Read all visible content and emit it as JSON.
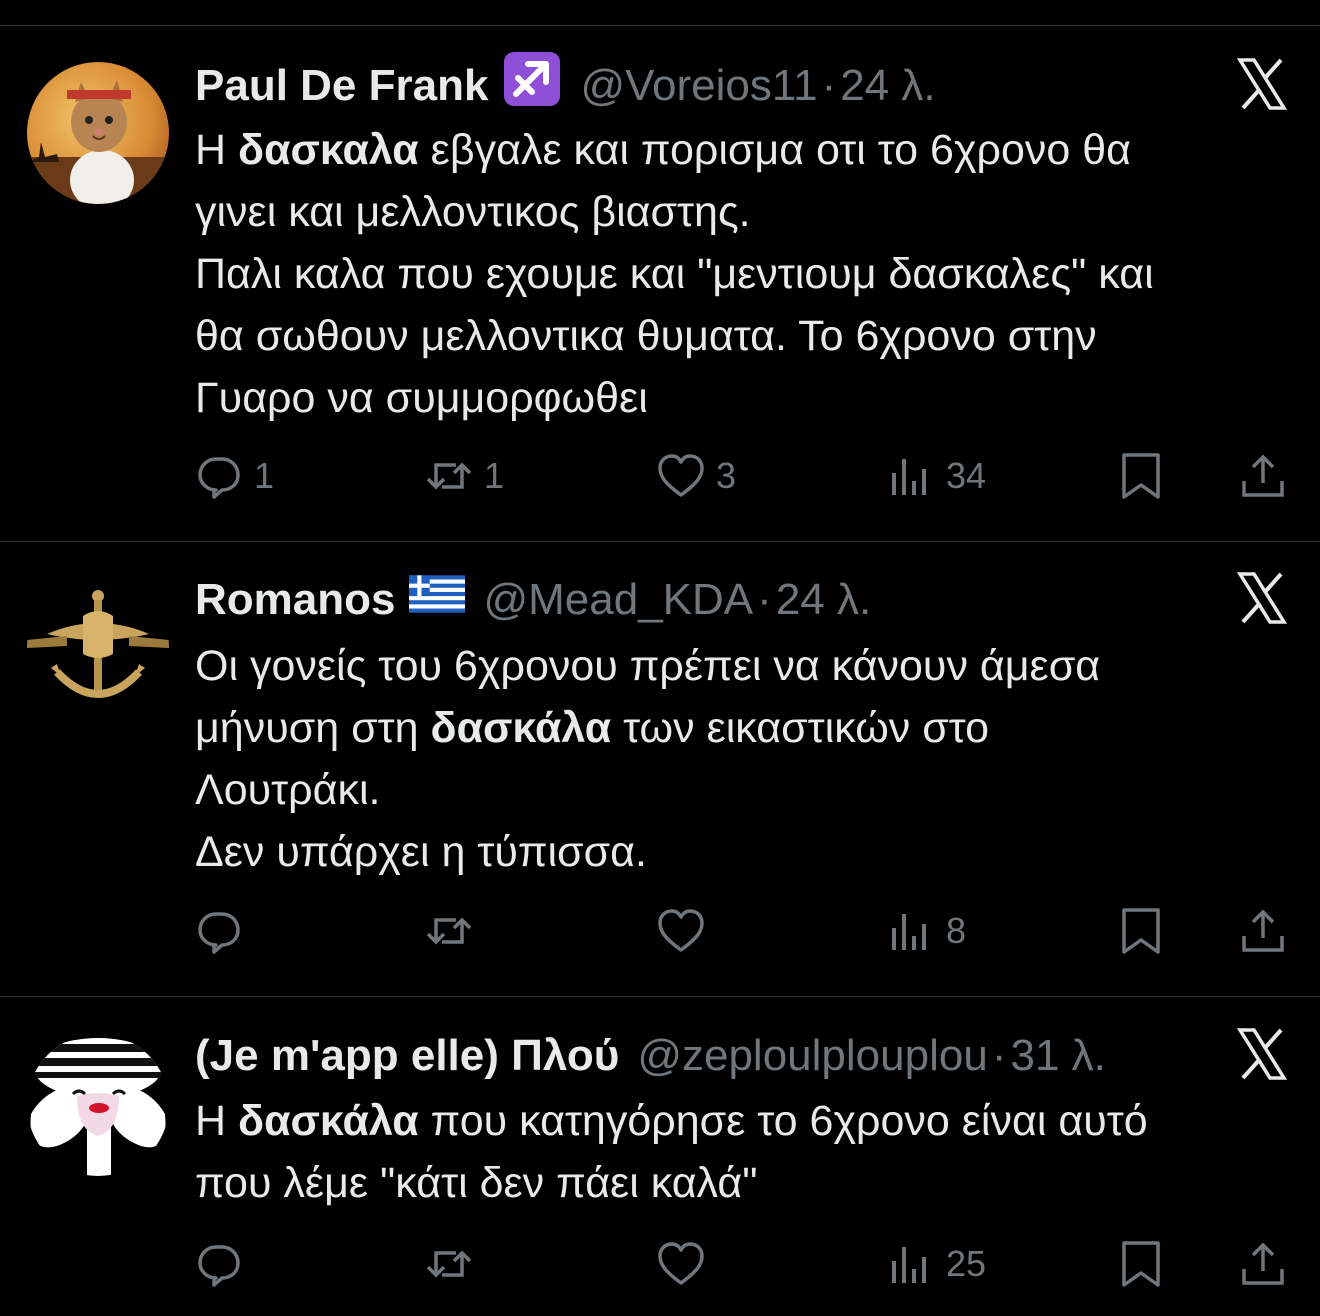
{
  "tweets": [
    {
      "name": "Paul De Frank",
      "badge": "sagittarius-emoji",
      "handle": "@Voreios11",
      "separator": "·",
      "time": "24 λ.",
      "lines": [
        [
          {
            "t": "Η "
          },
          {
            "t": "δασκαλα",
            "b": true
          },
          {
            "t": " εβγαλε και πορισμα οτι το 6χρονο θα"
          }
        ],
        [
          {
            "t": "γινει και μελλοντικος βιαστης."
          }
        ],
        [
          {
            "t": "Παλι καλα που εχουμε και \"μεντιουμ δασκαλες\" και"
          }
        ],
        [
          {
            "t": "θα σωθουν μελλοντικα θυματα. Το 6χρονο στην"
          }
        ],
        [
          {
            "t": "Γυαρο να συμμορφωθει"
          }
        ]
      ],
      "replies": "1",
      "reposts": "1",
      "likes": "3",
      "views": "34"
    },
    {
      "name": "Romanos",
      "badge": "greece-flag",
      "handle": "@Mead_KDA",
      "separator": "·",
      "time": "24 λ.",
      "lines": [
        [
          {
            "t": "Οι γονείς του 6χρονου πρέπει να κάνουν άμεσα"
          }
        ],
        [
          {
            "t": "μήνυση στη "
          },
          {
            "t": "δασκάλα",
            "b": true
          },
          {
            "t": " των εικαστικών στο"
          }
        ],
        [
          {
            "t": "Λουτράκι."
          }
        ],
        [
          {
            "t": "Δεν υπάρχει η τύπισσα."
          }
        ]
      ],
      "replies": "",
      "reposts": "",
      "likes": "",
      "views": "8"
    },
    {
      "name": "(Je m'app elle) Πλού",
      "badge": "",
      "handle": "@zeploulplouplou",
      "separator": "·",
      "time": "31 λ.",
      "lines": [
        [
          {
            "t": "Η "
          },
          {
            "t": "δασκάλα",
            "b": true
          },
          {
            "t": " που κατηγόρησε το 6χρονο είναι αυτό"
          }
        ],
        [
          {
            "t": "που λέμε \"κάτι δεν πάει καλά\""
          }
        ]
      ],
      "replies": "",
      "reposts": "",
      "likes": "",
      "views": "25"
    }
  ],
  "colors": {
    "background": "#000000",
    "text": "#e7e9ea",
    "muted": "#71767b",
    "divider": "#2f3336",
    "badge_purple": "#8e4fd6"
  },
  "icons": {
    "reply": "reply-icon",
    "repost": "repost-icon",
    "like": "heart-icon",
    "views": "views-icon",
    "bookmark": "bookmark-icon",
    "share": "share-icon",
    "close": "x-logo-icon"
  }
}
